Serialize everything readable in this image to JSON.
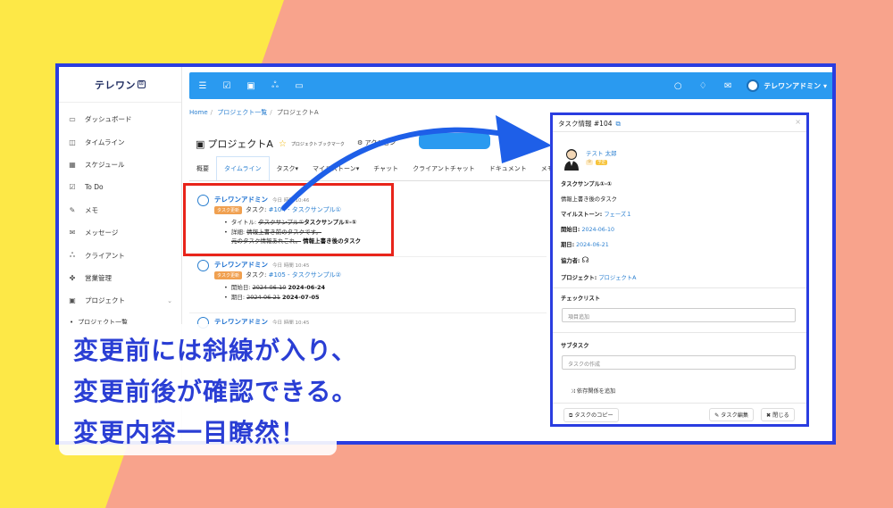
{
  "colors": {
    "frame": "#2a3de0",
    "highlight": "#e8241a",
    "topbar": "#2a9af0",
    "accent": "#2a7fd0",
    "caption_text": "#2a3ed4"
  },
  "app": {
    "logo": "テレワン"
  },
  "sidebar": {
    "items": [
      {
        "icon": "monitor-icon",
        "label": "ダッシュボード"
      },
      {
        "icon": "timeline-icon",
        "label": "タイムライン"
      },
      {
        "icon": "calendar-icon",
        "label": "スケジュール"
      },
      {
        "icon": "check-icon",
        "label": "To Do"
      },
      {
        "icon": "memo-icon",
        "label": "メモ"
      },
      {
        "icon": "mail-icon",
        "label": "メッセージ"
      },
      {
        "icon": "users-icon",
        "label": "クライアント"
      },
      {
        "icon": "handshake-icon",
        "label": "営業管理"
      },
      {
        "icon": "briefcase-icon",
        "label": "プロジェクト"
      }
    ],
    "sub_item": "プロジェクト一覧"
  },
  "topbar": {
    "user_name": "テレワンアドミン"
  },
  "breadcrumb": [
    "Home",
    "プロジェクト一覧",
    "プロジェクトA"
  ],
  "project": {
    "title": "プロジェクトA",
    "bookmark": "プロジェクトブックマーク",
    "action": "アクション"
  },
  "tabs": [
    "概要",
    "タイムライン",
    "タスク",
    "マイルストーン",
    "チャット",
    "クライアントチャット",
    "ドキュメント",
    "メモ"
  ],
  "activity": [
    {
      "user": "テレワンアドミン",
      "date": "今日",
      "time": "時間 10:46",
      "badge": "タスク更新",
      "prefix": "タスク:",
      "task_link": "#104 - タスクサンプル①",
      "title_label": "タイトル:",
      "title_old": "タスクサンプル①",
      "title_new": "タスクサンプル①-①",
      "detail_label": "詳細:",
      "detail_old_1": "情報上書き前のタスクです。",
      "detail_old_2": "元のタスク情報あれこれ。",
      "detail_new": "情報上書き後のタスク"
    },
    {
      "user": "テレワンアドミン",
      "date": "今日",
      "time": "時間 10:45",
      "badge": "タスク更新",
      "prefix": "タスク:",
      "task_link": "#105 - タスクサンプル②",
      "start_label": "開始日:",
      "start_old": "2024-06-10",
      "start_new": "2024-06-24",
      "due_label": "期日:",
      "due_old": "2024-06-21",
      "due_new": "2024-07-05"
    },
    {
      "user": "テレワンアドミン",
      "date": "今日",
      "time": "時間 10:45"
    }
  ],
  "panel": {
    "title": "タスク情報 #104",
    "user": "テスト 太郎",
    "badge_1": "①",
    "badge_2": "予定",
    "task_name": "タスクサンプル①-①",
    "description": "情報上書き後のタスク",
    "milestone_label": "マイルストーン:",
    "milestone": "フェーズ１",
    "start_label": "開始日:",
    "start": "2024-06-10",
    "due_label": "期日:",
    "due": "2024-06-21",
    "collaborator_label": "協力者:",
    "project_label": "プロジェクト:",
    "project": "プロジェクトA",
    "checklist_label": "チェックリスト",
    "checklist_placeholder": "項目追加",
    "subtask_label": "サブタスク",
    "subtask_placeholder": "タスクの作成",
    "dependency": "依存関係を追加",
    "copy": "タスクのコピー",
    "edit": "タスク編集",
    "close": "閉じる"
  },
  "caption": [
    "変更前には斜線が入り、",
    "変更前後が確認できる。",
    "変更内容一目瞭然！"
  ]
}
